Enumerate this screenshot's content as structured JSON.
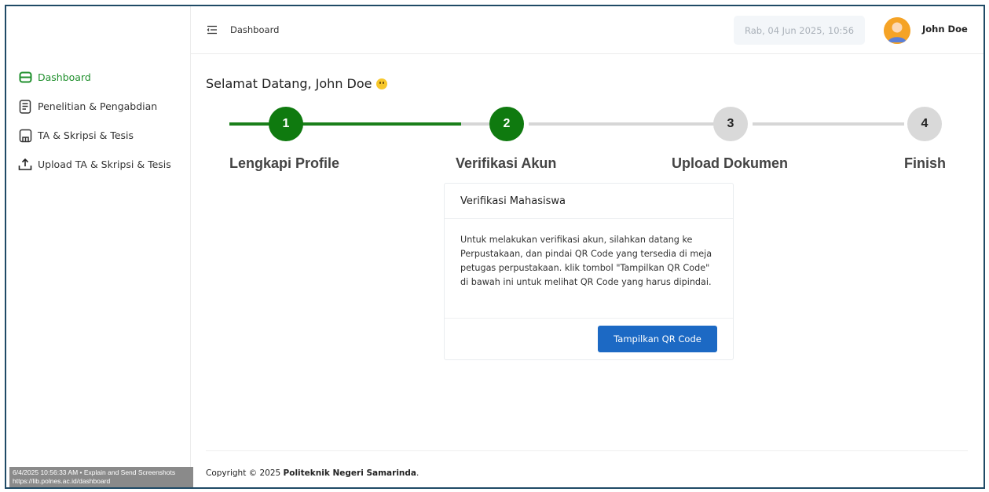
{
  "header": {
    "breadcrumb": "Dashboard",
    "datetime": "Rab, 04 Jun 2025, 10:56",
    "user_name": "John Doe"
  },
  "sidebar": {
    "items": [
      {
        "label": "Dashboard",
        "icon": "dashboard-icon",
        "active": true
      },
      {
        "label": "Penelitian & Pengabdian",
        "icon": "document-icon",
        "active": false
      },
      {
        "label": "TA & Skripsi & Tesis",
        "icon": "book-icon",
        "active": false
      },
      {
        "label": "Upload TA & Skripsi & Tesis",
        "icon": "upload-icon",
        "active": false
      }
    ],
    "screenshot_badge": {
      "line1": "6/4/2025 10:56:33 AM • Explain and Send Screenshots",
      "line2": "https://lib.polnes.ac.id/dashboard"
    }
  },
  "main": {
    "welcome": "Selamat Datang, John Doe",
    "steps": [
      {
        "number": "1",
        "label": "Lengkapi Profile",
        "status": "done"
      },
      {
        "number": "2",
        "label": "Verifikasi Akun",
        "status": "done"
      },
      {
        "number": "3",
        "label": "Upload Dokumen",
        "status": "todo"
      },
      {
        "number": "4",
        "label": "Finish",
        "status": "todo"
      }
    ],
    "card": {
      "title": "Verifikasi Mahasiswa",
      "body": "Untuk melakukan verifikasi akun, silahkan datang ke Perpustakaan, dan pindai QR Code yang tersedia di meja petugas perpustakaan. klik tombol \"Tampilkan QR Code\" di bawah ini untuk melihat QR Code yang harus dipindai.",
      "button": "Tampilkan QR Code"
    }
  },
  "footer": {
    "prefix": "Copyright © 2025 ",
    "org": "Politeknik Negeri Samarinda",
    "suffix": "."
  },
  "colors": {
    "accent_green": "#0f7a0f",
    "button_blue": "#1c69c4",
    "frame_border": "#1f4a66"
  }
}
